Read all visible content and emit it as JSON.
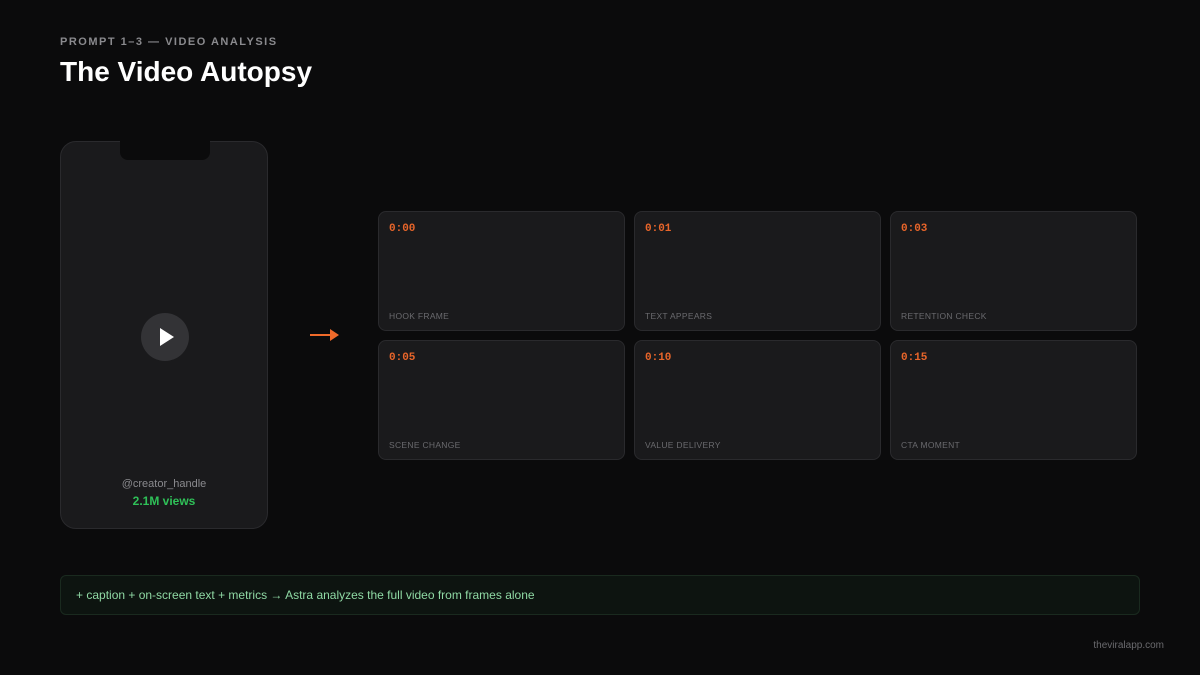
{
  "header": {
    "eyebrow": "PROMPT 1–3 — VIDEO ANALYSIS",
    "title": "The Video Autopsy"
  },
  "phone": {
    "handle": "@creator_handle",
    "views": "2.1M views"
  },
  "frames": [
    {
      "time": "0:00",
      "label": "HOOK FRAME"
    },
    {
      "time": "0:01",
      "label": "TEXT APPEARS"
    },
    {
      "time": "0:03",
      "label": "RETENTION CHECK"
    },
    {
      "time": "0:05",
      "label": "SCENE CHANGE"
    },
    {
      "time": "0:10",
      "label": "VALUE DELIVERY"
    },
    {
      "time": "0:15",
      "label": "CTA MOMENT"
    }
  ],
  "note": "+ caption + on-screen text + metrics → Astra analyzes the full video from frames alone",
  "footer": "theviralapp.com",
  "colors": {
    "accent": "#e8652a",
    "views_green": "#2fc158",
    "note_text": "#8fd9a4",
    "background": "#0b0b0c"
  }
}
